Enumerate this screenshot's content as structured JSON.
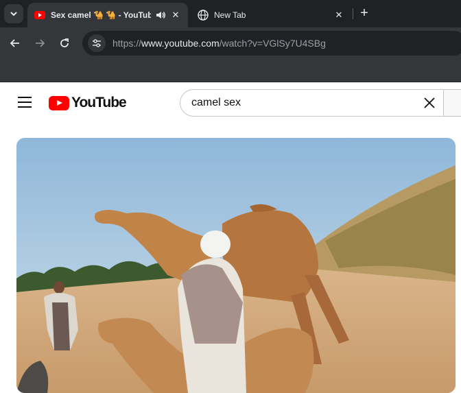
{
  "browser": {
    "tabs": [
      {
        "title": "Sex camel 🐪 🐪 - YouTube",
        "active": true,
        "icon": "youtube-favicon-icon",
        "audio": true
      },
      {
        "title": "New Tab",
        "active": false,
        "icon": "chrome-globe-icon",
        "audio": false
      }
    ],
    "url": {
      "scheme": "https://",
      "host": "www.youtube.com",
      "path": "/watch?v=VGlSy7U4SBg"
    },
    "accent": "#35363a"
  },
  "youtube": {
    "logo_text": "YouTube",
    "search_value": "camel sex",
    "brand_red": "#ff0000"
  }
}
